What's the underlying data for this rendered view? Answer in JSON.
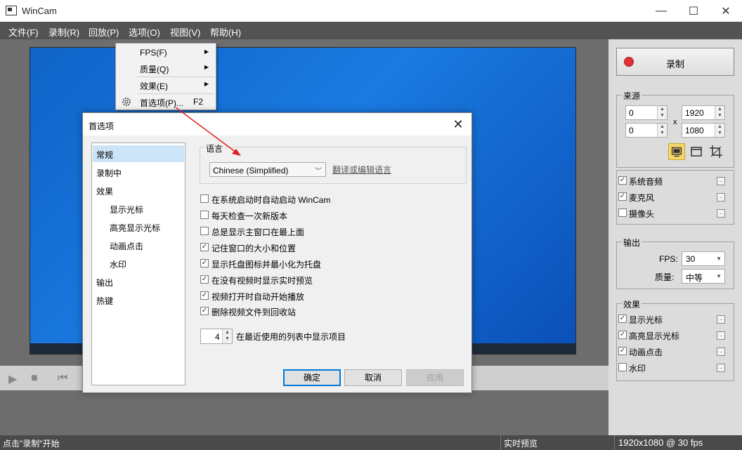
{
  "window": {
    "title": "WinCam",
    "minimize_glyph": "—",
    "maximize_glyph": "☐",
    "close_glyph": "✕"
  },
  "menubar": {
    "items": [
      "文件(F)",
      "录制(R)",
      "回放(P)",
      "选项(O)",
      "视图(V)",
      "帮助(H)"
    ]
  },
  "options_menu": {
    "items": [
      {
        "label": "FPS(F)",
        "has_submenu": true
      },
      {
        "label": "质量(Q)",
        "has_submenu": true
      },
      {
        "label": "效果(E)",
        "has_submenu": true
      },
      {
        "label": "首选项(P)...",
        "shortcut": "F2",
        "icon": "gear-icon"
      }
    ]
  },
  "preferences_dialog": {
    "title": "首选项",
    "nav": [
      {
        "label": "常规",
        "selected": true
      },
      {
        "label": "录制中"
      },
      {
        "label": "效果"
      },
      {
        "label": "显示光标",
        "indent": true
      },
      {
        "label": "高亮显示光标",
        "indent": true
      },
      {
        "label": "动画点击",
        "indent": true
      },
      {
        "label": "水印",
        "indent": true
      },
      {
        "label": "输出"
      },
      {
        "label": "热键"
      }
    ],
    "language": {
      "group_title": "语言",
      "selected": "Chinese (Simplified)",
      "link": "翻译或编辑语言"
    },
    "options": [
      {
        "label": "在系统启动时自动启动 WinCam",
        "checked": false
      },
      {
        "label": "每天检查一次新版本",
        "checked": false
      },
      {
        "label": "总是显示主窗口在最上面",
        "checked": false
      },
      {
        "label": "记住窗口的大小和位置",
        "checked": true
      },
      {
        "label": "显示托盘图标并最小化为托盘",
        "checked": true
      },
      {
        "label": "在没有视频时显示实时预览",
        "checked": true
      },
      {
        "label": "视频打开时自动开始播放",
        "checked": true
      },
      {
        "label": "删除视频文件到回收站",
        "checked": true
      }
    ],
    "recent_count": "4",
    "recent_label": "在最近使用的列表中显示项目",
    "buttons": {
      "ok": "确定",
      "cancel": "取消",
      "apply": "应用"
    }
  },
  "right_panel": {
    "record_label": "录制",
    "source": {
      "title": "来源",
      "x": "0",
      "y": "0",
      "width": "1920",
      "height": "1080",
      "separator": "x"
    },
    "audio": [
      {
        "label": "系统音频",
        "checked": true
      },
      {
        "label": "麦克风",
        "checked": true
      },
      {
        "label": "摄像头",
        "checked": false
      }
    ],
    "output": {
      "title": "输出",
      "fps_label": "FPS:",
      "fps_value": "30",
      "quality_label": "质量:",
      "quality_value": "中等"
    },
    "effects": {
      "title": "效果",
      "items": [
        {
          "label": "显示光标",
          "checked": true
        },
        {
          "label": "高亮显示光标",
          "checked": true
        },
        {
          "label": "动画点击",
          "checked": true
        },
        {
          "label": "水印",
          "checked": false
        }
      ]
    }
  },
  "statusbar": {
    "hint": "点击\"录制\"开始",
    "preview": "实时预览",
    "resolution": "1920x1080 @ 30 fps"
  },
  "colors": {
    "accent_blue": "#0078d7",
    "record_red": "#e03030",
    "annotation_arrow": "#e02020"
  }
}
